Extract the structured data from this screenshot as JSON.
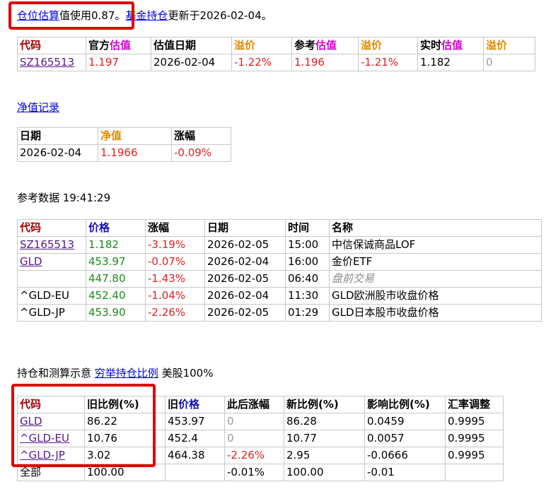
{
  "top": {
    "link1": "仓位估算",
    "text1": "值使用0.87。",
    "link2": "基金持仓",
    "text2": "更新于2026-02-04。"
  },
  "est_table": {
    "headers": [
      {
        "a": "代码",
        "b": ""
      },
      {
        "a": "官方",
        "b": "估值"
      },
      {
        "a": "估值日期",
        "b": ""
      },
      {
        "a": "溢价",
        "b": ""
      },
      {
        "a": "参考",
        "b": "估值"
      },
      {
        "a": "溢价",
        "b": ""
      },
      {
        "a": "实时",
        "b": "估值"
      },
      {
        "a": "溢价",
        "b": ""
      }
    ],
    "row": [
      "SZ165513",
      "1.197",
      "2026-02-04",
      "-1.22%",
      "1.196",
      "-1.21%",
      "1.182",
      "0"
    ]
  },
  "nav_link": "净值记录",
  "nav_table": {
    "headers": [
      "日期",
      "净值",
      "涨幅"
    ],
    "row": [
      "2026-02-04",
      "1.1966",
      "-0.09%"
    ]
  },
  "ref_title": "参考数据 19:41:29",
  "ref_table": {
    "headers": [
      "代码",
      "价格",
      "涨幅",
      "日期",
      "时间",
      "名称"
    ],
    "rows": [
      [
        "SZ165513",
        "1.182",
        "-3.19%",
        "2026-02-05",
        "15:00",
        "中信保诚商品LOF"
      ],
      [
        "GLD",
        "453.97",
        "-0.07%",
        "2026-02-04",
        "16:00",
        "金价ETF"
      ],
      [
        "",
        "447.80",
        "-1.43%",
        "2026-02-05",
        "06:40",
        "盘前交易"
      ],
      [
        "^GLD-EU",
        "452.40",
        "-1.04%",
        "2026-02-04",
        "11:30",
        "GLD欧洲股市收盘价格"
      ],
      [
        "^GLD-JP",
        "453.90",
        "-2.26%",
        "2026-02-05",
        "01:29",
        "GLD日本股市收盘价格"
      ]
    ]
  },
  "hold_title": {
    "text1": "持仓和测算示意",
    "link": "穷举持仓比例",
    "text2": "美股100%"
  },
  "hold_table": {
    "headers": [
      {
        "a": "代码",
        "b": ""
      },
      {
        "a": "旧比例(%)",
        "b": ""
      },
      {
        "a": "旧",
        "b": "价格"
      },
      {
        "a": "此后涨幅",
        "b": ""
      },
      {
        "a": "新比例(%)",
        "b": ""
      },
      {
        "a": "影响比例(%)",
        "b": ""
      },
      {
        "a": "汇率调整",
        "b": ""
      }
    ],
    "rows": [
      [
        "GLD",
        "86.22",
        "453.97",
        "0",
        "86.28",
        "0.0459",
        "0.9995"
      ],
      [
        "^GLD-EU",
        "10.76",
        "452.4",
        "0",
        "10.77",
        "0.0057",
        "0.9995"
      ],
      [
        "^GLD-JP",
        "3.02",
        "464.38",
        "-2.26%",
        "2.95",
        "-0.0666",
        "0.9995"
      ],
      [
        "全部",
        "100.00",
        "",
        "-0.01%",
        "100.00",
        "-0.01",
        ""
      ]
    ]
  },
  "colors": {
    "red": "#e02020",
    "green": "#1e8a1e",
    "orange": "#e08a00",
    "magenta": "#d000d0",
    "header_red": "#a00000",
    "highlight_box": "#e00000"
  }
}
